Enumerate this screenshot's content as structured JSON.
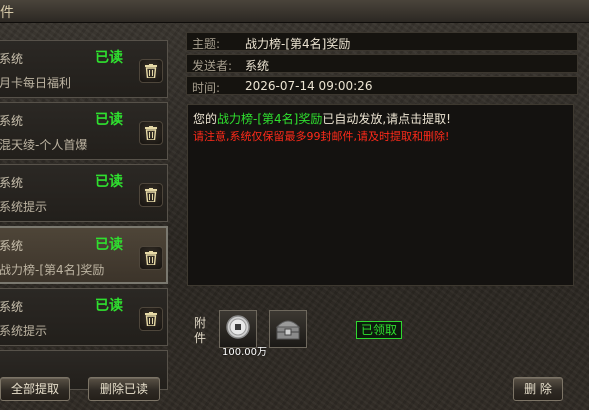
{
  "window": {
    "title": "件"
  },
  "mail_list": [
    {
      "sender": "系统",
      "status": "已读",
      "subject": "月卡每日福利",
      "selected": false
    },
    {
      "sender": "系统",
      "status": "已读",
      "subject": "混天绫-个人首爆",
      "selected": false
    },
    {
      "sender": "系统",
      "status": "已读",
      "subject": "系统提示",
      "selected": false
    },
    {
      "sender": "系统",
      "status": "已读",
      "subject": "战力榜-[第4名]奖励",
      "selected": true
    },
    {
      "sender": "系统",
      "status": "已读",
      "subject": "系统提示",
      "selected": false
    }
  ],
  "left_buttons": {
    "claim_all": "全部提取",
    "delete_read": "删除已读"
  },
  "detail": {
    "subject_label": "主题:",
    "subject_value": "战力榜-[第4名]奖励",
    "sender_label": "发送者:",
    "sender_value": "系统",
    "time_label": "时间:",
    "time_value": "2026-07-14 09:00:26",
    "body_prefix": "您的",
    "body_highlight": "战力榜-[第4名]奖励",
    "body_suffix": "已自动发放,请点击提取!",
    "body_warning": "请注意,系统仅保留最多99封邮件,请及时提取和删除!",
    "attachment_label": "附件",
    "attachments": [
      {
        "icon": "silver-coin-icon",
        "count": "100.00万"
      },
      {
        "icon": "treasure-chest-icon",
        "count": ""
      }
    ],
    "claimed_badge": "已领取",
    "delete_button": "删 除"
  },
  "colors": {
    "read_status": "#2fe02f",
    "highlight": "#2fe02f",
    "warning": "#ff2a1a"
  }
}
